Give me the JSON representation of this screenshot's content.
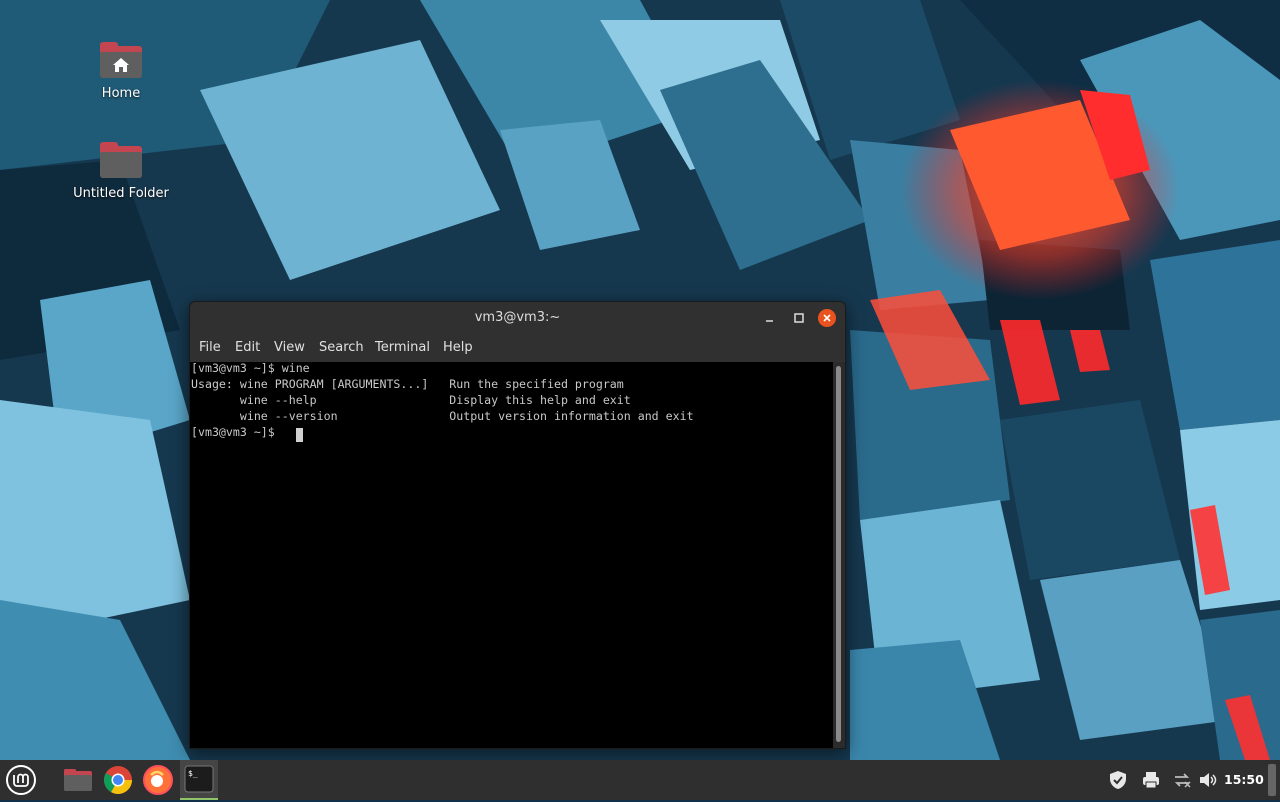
{
  "desktop": {
    "icons": [
      {
        "label": "Home",
        "icon": "home-folder-icon"
      },
      {
        "label": "Untitled Folder",
        "icon": "folder-icon"
      }
    ]
  },
  "terminal": {
    "title": "vm3@vm3:~",
    "menu": [
      "File",
      "Edit",
      "View",
      "Search",
      "Terminal",
      "Help"
    ],
    "lines": [
      "[vm3@vm3 ~]$ wine",
      "Usage: wine PROGRAM [ARGUMENTS...]   Run the specified program",
      "       wine --help                   Display this help and exit",
      "       wine --version                Output version information and exit",
      "[vm3@vm3 ~]$ "
    ]
  },
  "taskbar": {
    "clock": "15:50",
    "launchers": [
      "mint-menu-icon",
      "files-icon",
      "chrome-icon",
      "firefox-icon",
      "terminal-icon"
    ],
    "tray": [
      "shield-icon",
      "printer-icon",
      "network-icon",
      "volume-icon"
    ]
  },
  "colors": {
    "accent": "#8fc46a",
    "close": "#e9531f",
    "folder": "#c2454f"
  }
}
